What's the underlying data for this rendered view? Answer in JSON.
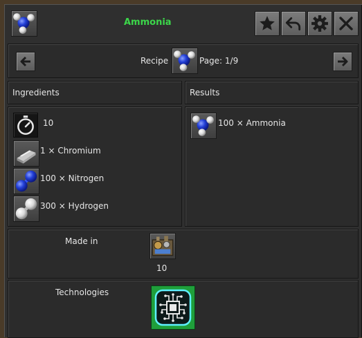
{
  "window": {
    "title": "Ammonia"
  },
  "toolbar": {
    "favorite_icon": "star-icon",
    "back_icon": "undo-arrow-icon",
    "settings_icon": "gear-icon",
    "close_icon": "close-icon"
  },
  "recipe_bar": {
    "label": "Recipe",
    "page": "Page: 1/9"
  },
  "ingredients": {
    "header": "Ingredients",
    "items": [
      {
        "icon": "stopwatch-icon",
        "text": "10"
      },
      {
        "icon": "chromium-plate-icon",
        "text": "1 × Chromium"
      },
      {
        "icon": "nitrogen-icon",
        "text": "100 × Nitrogen"
      },
      {
        "icon": "hydrogen-icon",
        "text": "300 × Hydrogen"
      }
    ]
  },
  "results": {
    "header": "Results",
    "items": [
      {
        "icon": "ammonia-icon",
        "text": "100 × Ammonia"
      }
    ]
  },
  "made_in": {
    "label": "Made in",
    "count": "10"
  },
  "technologies": {
    "label": "Technologies"
  },
  "colors": {
    "title_green": "#3cd64a",
    "background": "#2f2f2f",
    "tech_green": "#1f9f3b"
  }
}
